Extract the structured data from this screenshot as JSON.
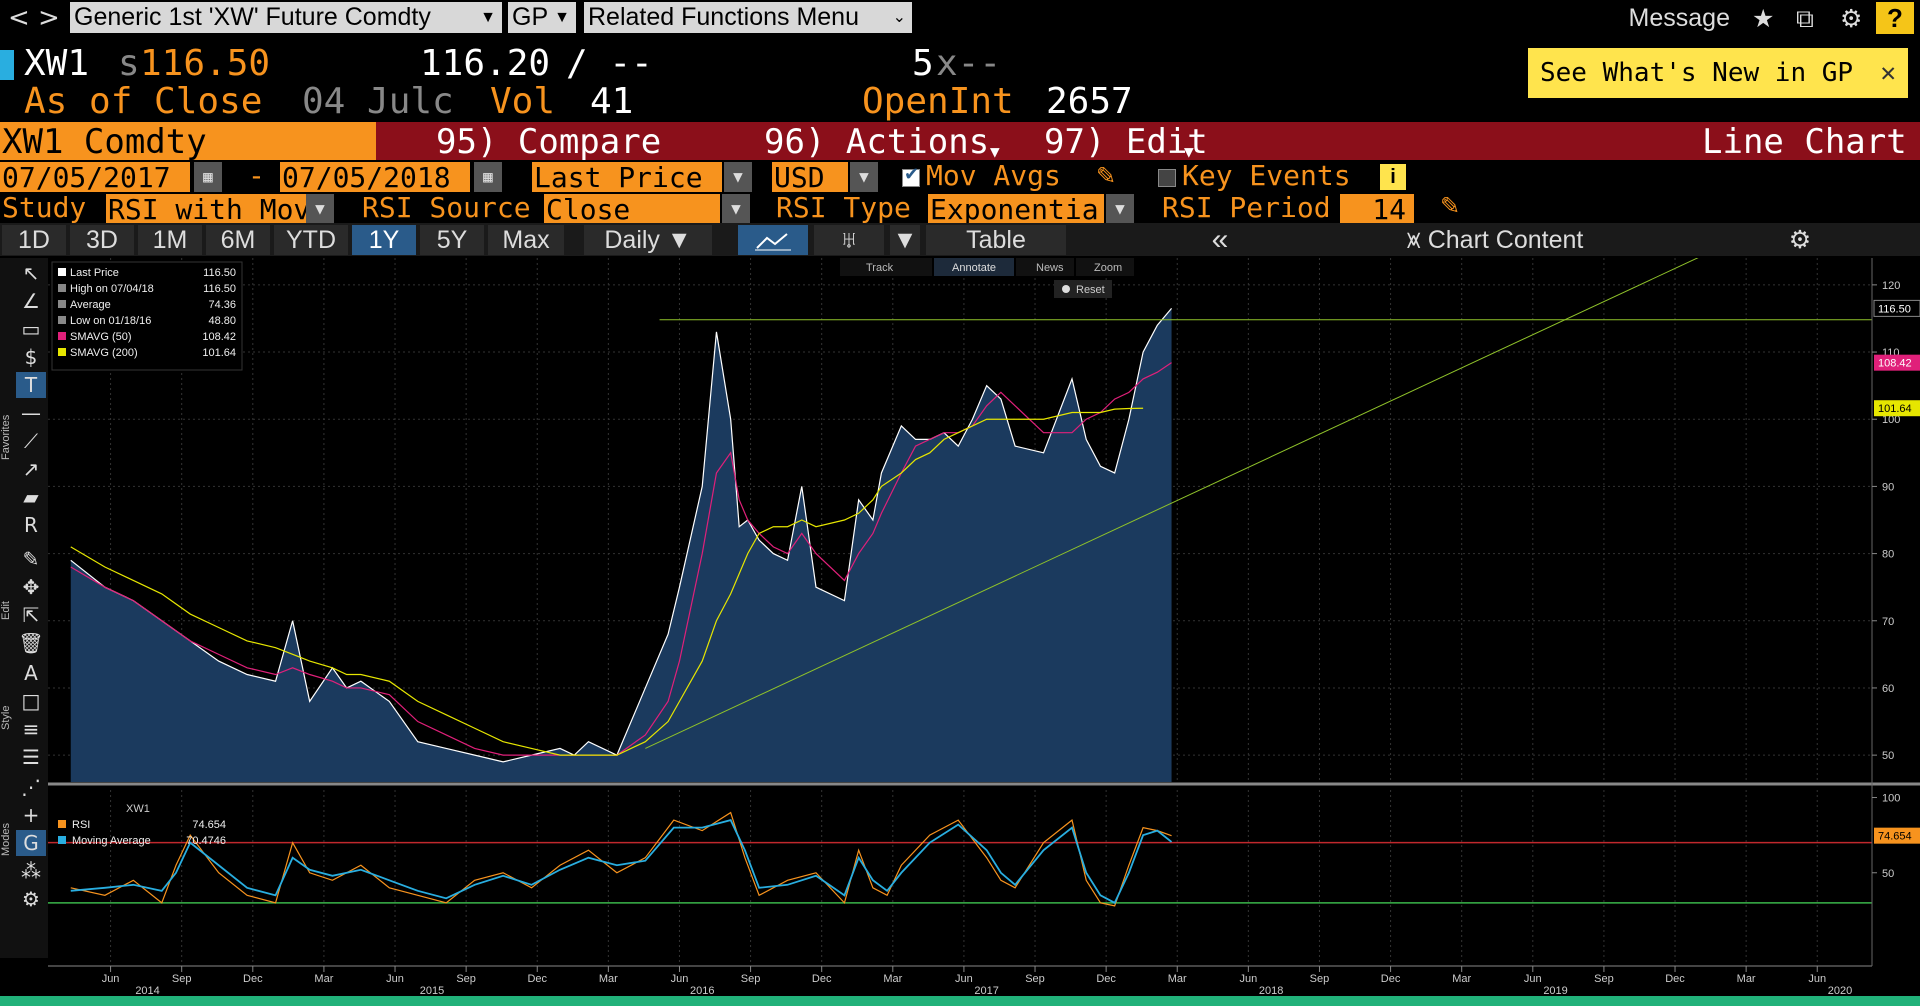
{
  "topbar": {
    "back": "<",
    "forward": ">",
    "security_combo": "Generic 1st 'XW' Future Comdty",
    "function_combo": "GP",
    "related_menu": "Related Functions Menu",
    "message": "Message",
    "help": "?"
  },
  "header": {
    "ticker": "XW1",
    "price_prefix": "s",
    "last_price": "116.50",
    "change": "116.20",
    "change_sep": "/ --",
    "size": "5",
    "size_x": "x--",
    "as_of": "As of Close",
    "as_of_date": "04 Julc",
    "vol_label": "Vol",
    "vol": "41",
    "openint_label": "OpenInt",
    "openint": "2657",
    "whats_new": "See What's New in GP",
    "whats_new_close": "✕"
  },
  "command_bar": {
    "security": "XW1 Comdty",
    "compare": "95) Compare",
    "actions": "96) Actions",
    "edit": "97) Edit",
    "chart_type": "Line Chart"
  },
  "params": {
    "start_date": "07/05/2017",
    "dash": "-",
    "end_date": "07/05/2018",
    "field": "Last Price",
    "currency": "USD",
    "mov_avgs": "Mov Avgs",
    "key_events": "Key Events",
    "study_label": "Study",
    "study": "RSI with Mov",
    "rsi_source_label": "RSI Source",
    "rsi_source": "Close",
    "rsi_type_label": "RSI Type",
    "rsi_type": "Exponentia",
    "rsi_period_label": "RSI Period",
    "rsi_period": "14"
  },
  "tabs": {
    "periods": [
      "1D",
      "3D",
      "1M",
      "6M",
      "YTD",
      "1Y",
      "5Y",
      "Max"
    ],
    "selected": "1Y",
    "frequency": "Daily",
    "table": "Table",
    "collapse": "«",
    "chart_content": "Chart Content"
  },
  "chart_toolbar": {
    "track": "Track",
    "annotate": "Annotate",
    "news": "News",
    "zoom": "Zoom",
    "reset": "Reset"
  },
  "left_labels": {
    "favorites": "Favorites",
    "edit": "Edit",
    "style": "Style",
    "modes": "Modes"
  },
  "colors": {
    "price_fill": "#1b3a5e",
    "price_line": "#ffffff",
    "smavg50": "#e0207a",
    "smavg200": "#e6e600",
    "trendline": "#8fc22a",
    "rsi": "#f7931e",
    "rsi_ma": "#29aee0",
    "overbought": "#c0282d",
    "oversold": "#39b54a",
    "accent": "#f7931e"
  },
  "chart_data": [
    {
      "type": "area",
      "legend": [
        {
          "label": "Last Price",
          "value": "116.50"
        },
        {
          "label": "High on 07/04/18",
          "value": "116.50"
        },
        {
          "label": "Average",
          "value": "74.36"
        },
        {
          "label": "Low on 01/18/16",
          "value": "48.80"
        },
        {
          "label": "SMAVG (50)",
          "value": "108.42"
        },
        {
          "label": "SMAVG (200)",
          "value": "101.64"
        }
      ],
      "ylim": [
        46,
        124
      ],
      "yticks": [
        50,
        60,
        70,
        80,
        90,
        100,
        110,
        120
      ],
      "last_labels": [
        "116.50",
        "108.42",
        "101.64"
      ],
      "x": [
        2014.28,
        2014.4,
        2014.5,
        2014.6,
        2014.7,
        2014.8,
        2014.9,
        2015.0,
        2015.06,
        2015.12,
        2015.2,
        2015.25,
        2015.3,
        2015.4,
        2015.5,
        2015.6,
        2015.7,
        2015.8,
        2015.9,
        2016.0,
        2016.05,
        2016.1,
        2016.2,
        2016.3,
        2016.38,
        2016.42,
        2016.5,
        2016.55,
        2016.6,
        2016.63,
        2016.66,
        2016.7,
        2016.75,
        2016.8,
        2016.85,
        2016.9,
        2017.0,
        2017.05,
        2017.1,
        2017.13,
        2017.2,
        2017.25,
        2017.3,
        2017.35,
        2017.4,
        2017.45,
        2017.5,
        2017.55,
        2017.6,
        2017.7,
        2017.8,
        2017.85,
        2017.9,
        2017.95,
        2018.0,
        2018.05,
        2018.1,
        2018.15,
        2018.2,
        2018.25,
        2018.3,
        2018.35,
        2018.4,
        2018.45,
        2018.5
      ],
      "series": [
        {
          "name": "Last Price",
          "values": [
            79,
            75,
            73,
            70,
            67,
            64,
            62,
            61,
            70,
            58,
            63,
            60,
            61,
            58,
            52,
            51,
            50,
            49,
            50,
            51,
            50,
            52,
            50,
            60,
            68,
            75,
            90,
            113,
            100,
            84,
            85,
            82,
            80,
            79,
            90,
            75,
            73,
            88,
            85,
            92,
            99,
            97,
            97,
            98,
            96,
            100,
            105,
            103,
            96,
            95,
            106,
            97,
            93,
            92,
            100,
            110,
            114,
            116.5,
            null,
            null,
            null,
            null,
            null,
            null,
            null
          ]
        },
        {
          "name": "SMAVG (50)",
          "values": [
            78,
            75,
            73,
            70,
            67,
            65,
            63,
            62,
            63,
            62,
            61,
            60,
            60,
            59,
            55,
            53,
            51,
            50,
            50,
            50,
            50,
            50,
            50,
            53,
            58,
            64,
            80,
            92,
            95,
            88,
            85,
            83,
            81,
            80,
            83,
            80,
            76,
            80,
            83,
            86,
            92,
            96,
            97,
            98,
            98,
            99,
            102,
            104,
            102,
            98,
            98,
            100,
            101,
            103,
            104,
            106,
            107,
            108.42,
            null,
            null,
            null,
            null,
            null,
            null,
            null
          ]
        },
        {
          "name": "SMAVG (200)",
          "values": [
            81,
            78,
            76,
            74,
            71,
            69,
            67,
            66,
            65,
            64,
            63,
            62,
            62,
            61,
            58,
            56,
            54,
            52,
            51,
            50,
            50,
            50,
            50,
            52,
            55,
            58,
            64,
            70,
            74,
            77,
            80,
            83,
            84,
            84,
            85,
            84,
            85,
            86,
            88,
            90,
            92,
            94,
            95,
            97,
            98,
            99,
            100,
            100,
            100,
            100,
            101,
            101,
            101,
            101.5,
            101.6,
            101.64,
            null,
            null,
            null,
            null,
            null,
            null,
            null,
            null,
            null
          ]
        }
      ],
      "horizontal_line": 114.8,
      "trendline": {
        "from": [
          2016.3,
          51
        ],
        "to": [
          2020.1,
          126
        ]
      }
    },
    {
      "type": "line",
      "title": "XW1",
      "legend": [
        {
          "label": "RSI",
          "value": "74.654"
        },
        {
          "label": "Moving Average",
          "value": "70.4746"
        }
      ],
      "ylim": [
        0,
        105
      ],
      "yticks": [
        50,
        100
      ],
      "levels": [
        70,
        30
      ],
      "last_label": "74.654",
      "x": [
        2014.28,
        2014.4,
        2014.5,
        2014.6,
        2014.65,
        2014.7,
        2014.8,
        2014.9,
        2015.0,
        2015.06,
        2015.12,
        2015.2,
        2015.3,
        2015.4,
        2015.5,
        2015.6,
        2015.7,
        2015.8,
        2015.9,
        2016.0,
        2016.1,
        2016.2,
        2016.3,
        2016.4,
        2016.5,
        2016.6,
        2016.65,
        2016.7,
        2016.8,
        2016.9,
        2017.0,
        2017.05,
        2017.1,
        2017.15,
        2017.2,
        2017.3,
        2017.4,
        2017.5,
        2017.55,
        2017.6,
        2017.7,
        2017.8,
        2017.85,
        2017.9,
        2017.95,
        2018.0,
        2018.05,
        2018.1,
        2018.15
      ],
      "series": [
        {
          "name": "RSI",
          "values": [
            40,
            35,
            45,
            30,
            55,
            75,
            50,
            35,
            30,
            70,
            50,
            45,
            55,
            40,
            35,
            30,
            45,
            50,
            40,
            55,
            65,
            50,
            60,
            85,
            78,
            90,
            60,
            35,
            45,
            50,
            30,
            65,
            40,
            35,
            55,
            75,
            85,
            60,
            45,
            40,
            70,
            85,
            45,
            30,
            28,
            55,
            80,
            78,
            74.654
          ]
        },
        {
          "name": "Moving Average",
          "values": [
            38,
            40,
            42,
            38,
            50,
            70,
            55,
            40,
            35,
            60,
            52,
            48,
            52,
            45,
            38,
            33,
            42,
            48,
            42,
            52,
            60,
            55,
            58,
            80,
            80,
            85,
            65,
            40,
            42,
            48,
            35,
            60,
            45,
            38,
            50,
            70,
            82,
            65,
            50,
            42,
            65,
            80,
            50,
            35,
            30,
            50,
            75,
            78,
            70.4746
          ]
        }
      ]
    },
    {
      "type": "axis",
      "month_ticks": [
        {
          "x": 2014.42,
          "label": "Jun"
        },
        {
          "x": 2014.67,
          "label": "Sep"
        },
        {
          "x": 2014.92,
          "label": "Dec"
        },
        {
          "x": 2015.17,
          "label": "Mar"
        },
        {
          "x": 2015.42,
          "label": "Jun"
        },
        {
          "x": 2015.67,
          "label": "Sep"
        },
        {
          "x": 2015.92,
          "label": "Dec"
        },
        {
          "x": 2016.17,
          "label": "Mar"
        },
        {
          "x": 2016.42,
          "label": "Jun"
        },
        {
          "x": 2016.67,
          "label": "Sep"
        },
        {
          "x": 2016.92,
          "label": "Dec"
        },
        {
          "x": 2017.17,
          "label": "Mar"
        },
        {
          "x": 2017.42,
          "label": "Jun"
        },
        {
          "x": 2017.67,
          "label": "Sep"
        },
        {
          "x": 2017.92,
          "label": "Dec"
        },
        {
          "x": 2018.17,
          "label": "Mar"
        },
        {
          "x": 2018.42,
          "label": "Jun"
        },
        {
          "x": 2018.67,
          "label": "Sep"
        },
        {
          "x": 2018.92,
          "label": "Dec"
        },
        {
          "x": 2019.17,
          "label": "Mar"
        },
        {
          "x": 2019.42,
          "label": "Jun"
        },
        {
          "x": 2019.67,
          "label": "Sep"
        },
        {
          "x": 2019.92,
          "label": "Dec"
        },
        {
          "x": 2020.17,
          "label": "Mar"
        },
        {
          "x": 2020.42,
          "label": "Jun"
        }
      ],
      "year_ticks": [
        {
          "x": 2014.55,
          "label": "2014"
        },
        {
          "x": 2015.55,
          "label": "2015"
        },
        {
          "x": 2016.5,
          "label": "2016"
        },
        {
          "x": 2017.5,
          "label": "2017"
        },
        {
          "x": 2018.5,
          "label": "2018"
        },
        {
          "x": 2019.5,
          "label": "2019"
        },
        {
          "x": 2020.5,
          "label": "2020"
        }
      ],
      "xlim": [
        2014.2,
        2020.5
      ]
    }
  ]
}
